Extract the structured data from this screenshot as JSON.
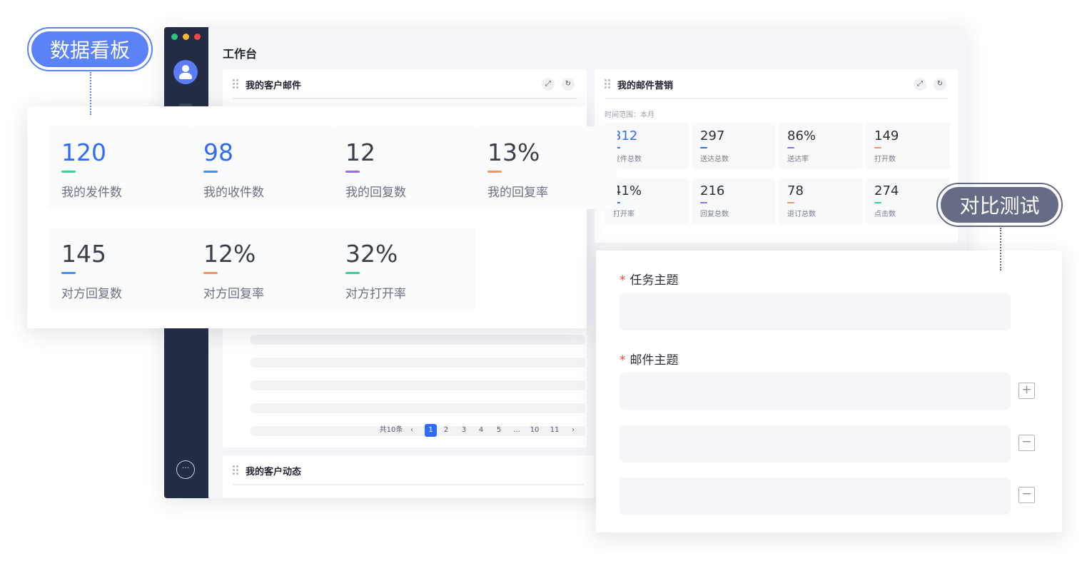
{
  "window": {
    "title": "工作台",
    "traffic_lights": [
      "#2ec27e",
      "#f5b82e",
      "#f04747"
    ],
    "sidebar_more": "···",
    "sidebar_bottom": "···"
  },
  "card_customer_email": {
    "title": "我的客户邮件",
    "pager": {
      "total": "共10条",
      "prev": "‹",
      "pages": [
        "1",
        "2",
        "3",
        "4",
        "5",
        "...",
        "10",
        "11"
      ],
      "next": "›",
      "active": "1"
    }
  },
  "card_email_marketing": {
    "title": "我的邮件营销",
    "range_label": "时间范围：本月",
    "stats": [
      {
        "value": "312",
        "label": "发件总数",
        "color": "#2f6bff"
      },
      {
        "value": "297",
        "label": "送达总数",
        "color": "#2f6bff"
      },
      {
        "value": "86%",
        "label": "送达率",
        "color": "#9b6bf2"
      },
      {
        "value": "149",
        "label": "打开数",
        "color": "#f2946b"
      },
      {
        "value": "41%",
        "label": "打开率",
        "color": "#2f6bff"
      },
      {
        "value": "216",
        "label": "回复总数",
        "color": "#9b6bf2"
      },
      {
        "value": "78",
        "label": "退订总数",
        "color": "#f2946b"
      },
      {
        "value": "274",
        "label": "点击数",
        "color": "#3ecf9a"
      }
    ]
  },
  "card_customer_activity": {
    "title": "我的客户动态"
  },
  "header_icons": {
    "expand": "expand-icon",
    "refresh": "refresh-icon"
  },
  "dashboard_panel": {
    "stats": [
      {
        "value": "120",
        "label": "我的发件数",
        "value_color": "#2f6bff",
        "bar_color": "#3ecf9a"
      },
      {
        "value": "98",
        "label": "我的收件数",
        "value_color": "#2f6bff",
        "bar_color": "#4a8cff"
      },
      {
        "value": "12",
        "label": "我的回复数",
        "value_color": "#3a3f4c",
        "bar_color": "#9b6bf2"
      },
      {
        "value": "13%",
        "label": "我的回复率",
        "value_color": "#3a3f4c",
        "bar_color": "#f2946b"
      },
      {
        "value": "145",
        "label": "对方回复数",
        "value_color": "#3a3f4c",
        "bar_color": "#4a8cff"
      },
      {
        "value": "12%",
        "label": "对方回复率",
        "value_color": "#3a3f4c",
        "bar_color": "#f2946b"
      },
      {
        "value": "32%",
        "label": "对方打开率",
        "value_color": "#3a3f4c",
        "bar_color": "#3ecf9a"
      }
    ]
  },
  "form_panel": {
    "task_subject_label": "任务主题",
    "email_subject_label": "邮件主题",
    "required_mark": "*",
    "add_label": "+",
    "remove_label": "−"
  },
  "callouts": {
    "dashboard": {
      "text": "数据看板",
      "color": "#5b82f6"
    },
    "compare": {
      "text": "对比测试",
      "color": "#666c85"
    }
  }
}
